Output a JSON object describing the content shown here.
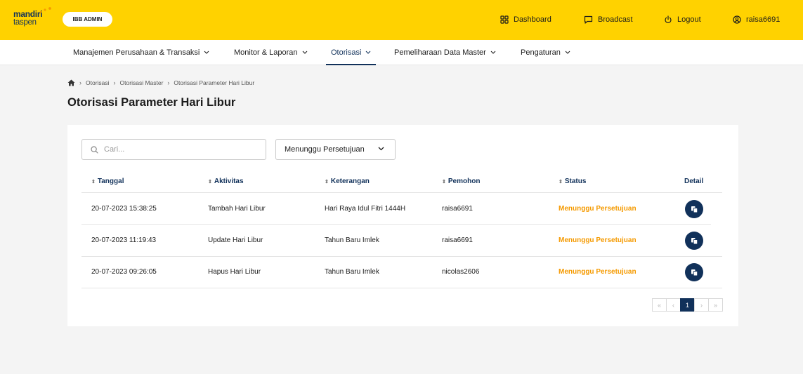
{
  "header": {
    "brand_line1": "mandiri",
    "brand_line2": "taspen",
    "role_badge": "IBB ADMIN",
    "dashboard": "Dashboard",
    "broadcast": "Broadcast",
    "logout": "Logout",
    "username": "raisa6691",
    "brand_color": "#ffd200"
  },
  "nav": {
    "items": [
      {
        "label": "Manajemen Perusahaan & Transaksi"
      },
      {
        "label": "Monitor & Laporan"
      },
      {
        "label": "Otorisasi"
      },
      {
        "label": "Pemeliharaan Data Master"
      },
      {
        "label": "Pengaturan"
      }
    ],
    "active_label": "Otorisasi"
  },
  "breadcrumb": [
    "Otorisasi",
    "Otorisasi Master",
    "Otorisasi Parameter Hari Libur"
  ],
  "page_title": "Otorisasi Parameter Hari Libur",
  "filters": {
    "search_placeholder": "Cari...",
    "status_selected": "Menunggu Persetujuan"
  },
  "table": {
    "columns": [
      "Tanggal",
      "Aktivitas",
      "Keterangan",
      "Pemohon",
      "Status",
      "Detail"
    ],
    "rows": [
      [
        "20-07-2023 15:38:25",
        "Tambah Hari Libur",
        "Hari Raya Idul Fitri 1444H",
        "raisa6691",
        "Menunggu Persetujuan"
      ],
      [
        "20-07-2023 11:19:43",
        "Update Hari Libur",
        "Tahun Baru Imlek",
        "raisa6691",
        "Menunggu Persetujuan"
      ],
      [
        "20-07-2023 09:26:05",
        "Hapus Hari Libur",
        "Tahun Baru Imlek",
        "nicolas2606",
        "Menunggu Persetujuan"
      ]
    ]
  },
  "pagination": {
    "first": "«",
    "prev": "‹",
    "current": "1",
    "next": "›",
    "last": "»"
  },
  "colors": {
    "primary": "#11315a",
    "status_pending": "#f59a00"
  }
}
